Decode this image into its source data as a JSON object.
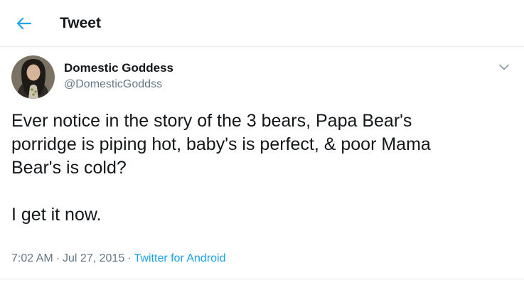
{
  "header": {
    "title": "Tweet",
    "back_icon": "arrow-left-icon",
    "accent_color": "#1da1f2"
  },
  "tweet": {
    "author": {
      "display_name": "Domestic Goddess",
      "handle": "@DomesticGoddss",
      "avatar_icon": "profile-photo"
    },
    "menu_icon": "chevron-down-icon",
    "text_lines": [
      "Ever notice in the story of the 3 bears, Papa Bear's",
      "porridge is piping hot, baby's is perfect, & poor Mama",
      "Bear's is cold?",
      "I get it now."
    ],
    "time": "7:02 AM",
    "date": "Jul 27, 2015",
    "separator": "·",
    "source": "Twitter for Android"
  },
  "colors": {
    "text": "#14171a",
    "secondary": "#657786",
    "border": "#e6ecf0"
  }
}
